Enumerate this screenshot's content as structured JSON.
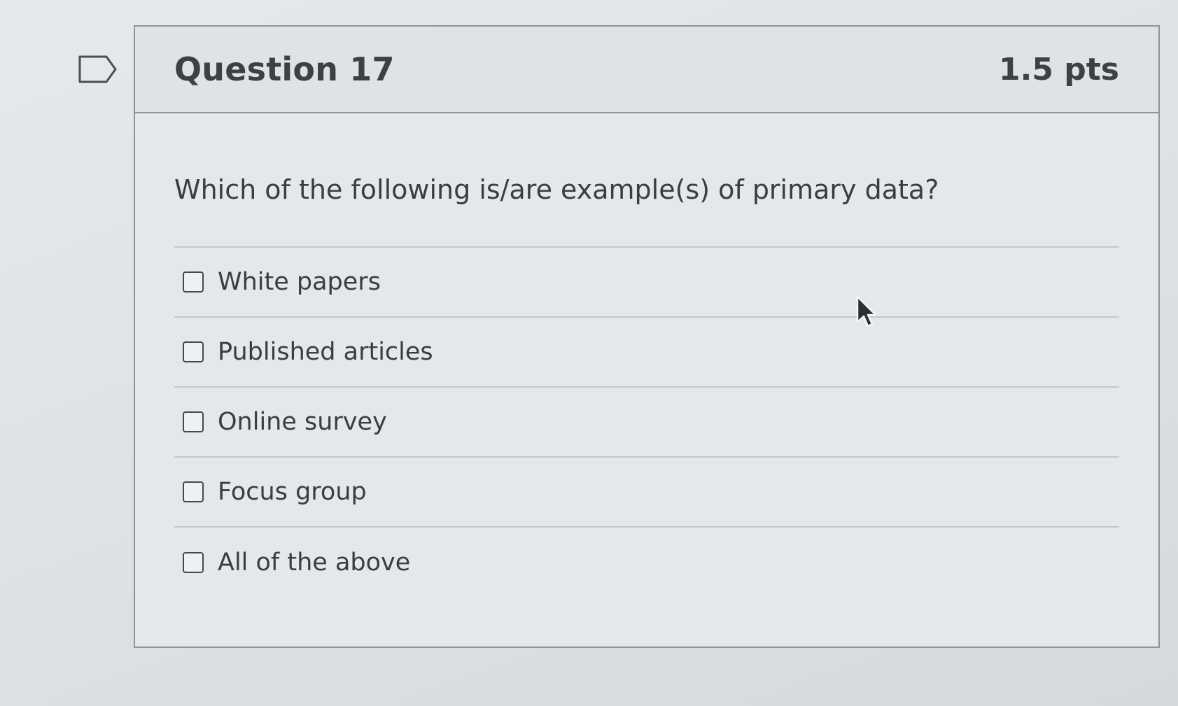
{
  "question": {
    "title": "Question 17",
    "points": "1.5 pts",
    "text": "Which of the following is/are example(s) of primary data?",
    "answers": [
      {
        "label": "White papers",
        "checked": false
      },
      {
        "label": "Published articles",
        "checked": false
      },
      {
        "label": "Online survey",
        "checked": false
      },
      {
        "label": "Focus group",
        "checked": false
      },
      {
        "label": "All of the above",
        "checked": false
      }
    ]
  },
  "icons": {
    "flag": "flag-question-icon",
    "cursor": "mouse-pointer-icon",
    "checkbox": "checkbox-empty-icon"
  },
  "colors": {
    "border": "#8e9499",
    "text": "#3a3e42",
    "divider": "#c3c8cc"
  }
}
